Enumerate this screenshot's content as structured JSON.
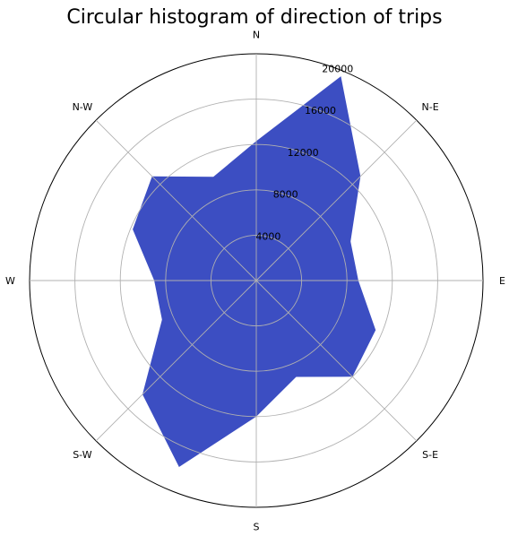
{
  "chart_data": {
    "type": "area",
    "projection": "polar",
    "title": "Circular histogram of direction of trips",
    "direction_labels": [
      "N",
      "N-E",
      "E",
      "S-E",
      "S",
      "S-W",
      "W",
      "N-W"
    ],
    "r_ticks": [
      "4000",
      "8000",
      "12000",
      "16000",
      "20000"
    ],
    "rlim": [
      0,
      20000
    ],
    "grid": true,
    "fill_color": "#3c4ec2",
    "x_unit": "degrees clockwise from N",
    "x": [
      0,
      22.5,
      45,
      67.5,
      90,
      112.5,
      135,
      157.5,
      180,
      202.5,
      225,
      247.5,
      270,
      292.5,
      315,
      337.5
    ],
    "values": [
      12300,
      19500,
      13000,
      9000,
      9000,
      11400,
      12000,
      9200,
      12000,
      17800,
      14200,
      9000,
      9000,
      11800,
      13000,
      9900
    ]
  }
}
